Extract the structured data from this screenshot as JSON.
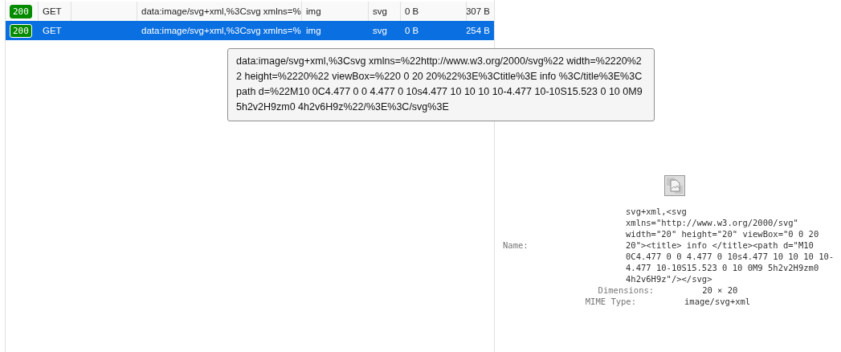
{
  "requests": [
    {
      "status": "200",
      "method": "GET",
      "url": "data:image/svg+xml,%3Csvg xmlns=%",
      "type": "img",
      "extension": "svg",
      "transferred": "0 B",
      "size": "307 B",
      "selected": false
    },
    {
      "status": "200",
      "method": "GET",
      "url": "data:image/svg+xml,%3Csvg xmlns=%",
      "type": "img",
      "extension": "svg",
      "transferred": "0 B",
      "size": "254 B",
      "selected": true
    }
  ],
  "tooltip": {
    "text": "data:image/svg+xml,%3Csvg xmlns=%22http://www.w3.org/2000/svg%22 width=%2220%22 height=%2220%22 viewBox=%220 0 20 20%22%3E%3Ctitle%3E info %3C/title%3E%3Cpath d=%22M10 0C4.477 0 0 4.477 0 10s4.477 10 10 10 10-4.477 10-10S15.523 0 10 0M9 5h2v2H9zm0 4h2v6H9z%22/%3E%3C/svg%3E"
  },
  "preview": {
    "name_label": "Name:",
    "name": "svg+xml,<svg xmlns=\"http://www.w3.org/2000/svg\" width=\"20\" height=\"20\" viewBox=\"0 0 20 20\"><title> info </title><path d=\"M10 0C4.477 0 0 4.477 0 10s4.477 10 10 10 10-4.477 10-10S15.523 0 10 0M9 5h2v2H9zm0 4h2v6H9z\"/></svg>",
    "details": [
      {
        "label": "Dimensions:",
        "value": "20 × 20"
      },
      {
        "label": "MIME Type:",
        "value": "image/svg+xml"
      }
    ]
  }
}
